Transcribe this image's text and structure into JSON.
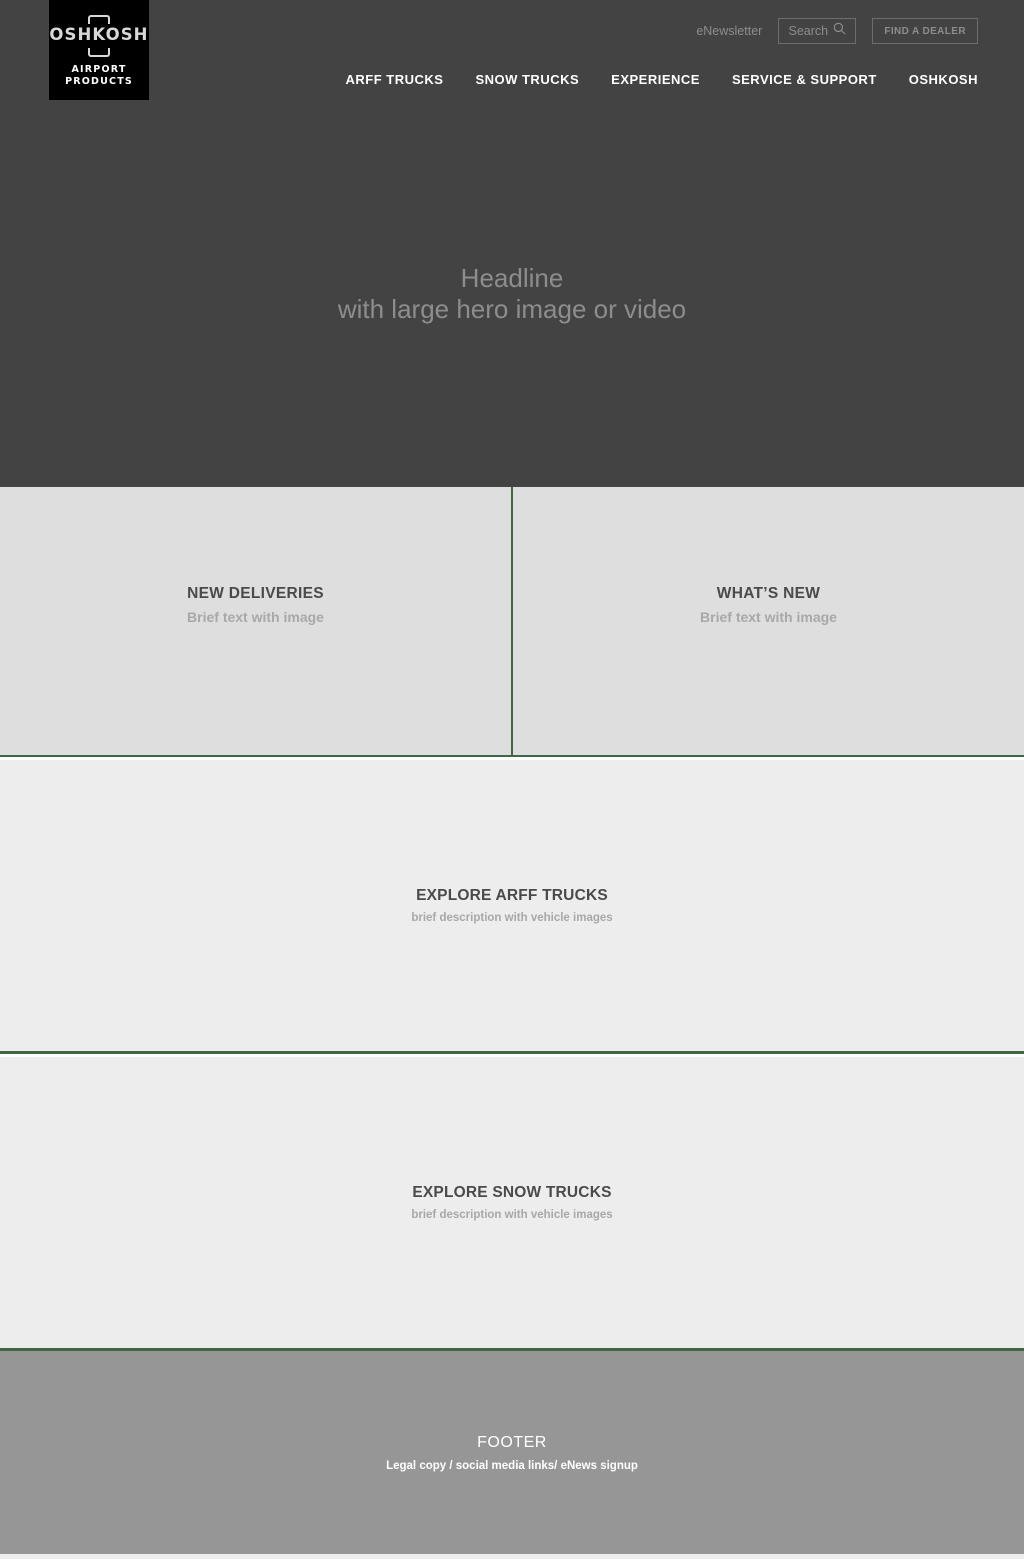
{
  "header": {
    "logo": {
      "wordmark": "OSHKOSH",
      "subtitle_line1": "AIRPORT",
      "subtitle_line2": "PRODUCTS",
      "background": "#000000"
    },
    "utility": {
      "enewsletter_label": "eNewsletter",
      "search_placeholder": "Search",
      "search_icon": "search-icon",
      "find_dealer_label": "FIND A DEALER"
    },
    "nav_items": [
      {
        "label": "ARFF TRUCKS"
      },
      {
        "label": "SNOW TRUCKS"
      },
      {
        "label": "EXPERIENCE"
      },
      {
        "label": "SERVICE & SUPPORT"
      },
      {
        "label": "OSHKOSH"
      }
    ],
    "background": "#434343"
  },
  "hero": {
    "line1": "Headline",
    "line2": "with large hero image or video",
    "background": "#434343",
    "text_color": "#8d8d8d"
  },
  "promo_columns": [
    {
      "title": "NEW DELIVERIES",
      "subtitle": "Brief text with image"
    },
    {
      "title": "WHAT’S NEW",
      "subtitle": "Brief text with image"
    }
  ],
  "explore_sections": [
    {
      "title": "EXPLORE ARFF TRUCKS",
      "subtitle": "brief description with vehicle images"
    },
    {
      "title": "EXPLORE SNOW TRUCKS",
      "subtitle": "brief description with vehicle images"
    }
  ],
  "footer": {
    "title": "FOOTER",
    "subtitle": "Legal copy / social media links/ eNews signup",
    "background": "#969696"
  },
  "theme": {
    "accent_green": "#406644",
    "dark_gray": "#434343",
    "panel_gray": "#dedede",
    "light_gray": "#ededed"
  }
}
